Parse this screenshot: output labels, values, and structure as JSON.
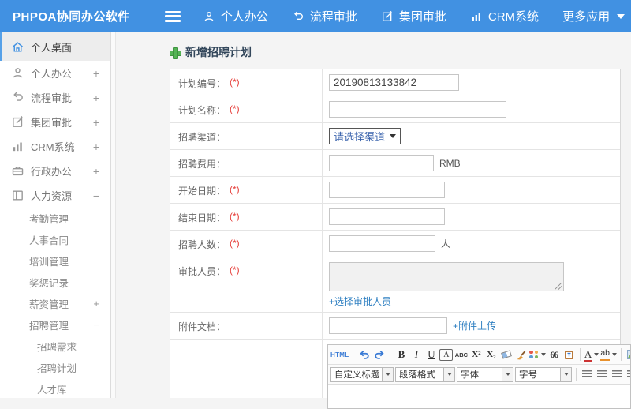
{
  "colors": {
    "topbar_blue": "#4191e2",
    "active_border_blue": "#57a1e8",
    "link_blue": "#2e7fc1",
    "required_red": "#e6403c",
    "title_plus_green": "#55b455"
  },
  "topbar": {
    "logo": "PHPOA协同办公软件",
    "nav": [
      {
        "label": "个人办公",
        "icon": "person-icon"
      },
      {
        "label": "流程审批",
        "icon": "process-arrow-icon"
      },
      {
        "label": "集团审批",
        "icon": "edit-square-icon"
      },
      {
        "label": "CRM系统",
        "icon": "bar-chart-icon"
      },
      {
        "label": "更多应用",
        "icon": "caret-down-icon"
      }
    ]
  },
  "sidebar": {
    "items": [
      {
        "label": "个人桌面",
        "icon": "home-icon",
        "active": true,
        "expander": ""
      },
      {
        "label": "个人办公",
        "icon": "person-icon",
        "expander": "+"
      },
      {
        "label": "流程审批",
        "icon": "process-arrow-icon",
        "expander": "+"
      },
      {
        "label": "集团审批",
        "icon": "edit-square-icon",
        "expander": "+"
      },
      {
        "label": "CRM系统",
        "icon": "bar-chart-icon",
        "expander": "+"
      },
      {
        "label": "行政办公",
        "icon": "briefcase-icon",
        "expander": "+"
      },
      {
        "label": "人力资源",
        "icon": "book-icon",
        "expander": "−"
      }
    ],
    "hr_submenu": [
      {
        "label": "考勤管理",
        "expander": ""
      },
      {
        "label": "人事合同",
        "expander": ""
      },
      {
        "label": "培训管理",
        "expander": ""
      },
      {
        "label": "奖惩记录",
        "expander": ""
      },
      {
        "label": "薪资管理",
        "expander": "+"
      },
      {
        "label": "招聘管理",
        "expander": "−"
      }
    ],
    "recruit_submenu": [
      {
        "label": "招聘需求"
      },
      {
        "label": "招聘计划"
      },
      {
        "label": "人才库"
      }
    ]
  },
  "main": {
    "title": "新增招聘计划",
    "form": {
      "rows": [
        {
          "label": "计划编号：",
          "required": "(*)",
          "value": "20190813133842"
        },
        {
          "label": "计划名称：",
          "required": "(*)",
          "value": ""
        },
        {
          "label": "招聘渠道：",
          "select_value": "请选择渠道"
        },
        {
          "label": "招聘费用：",
          "value": "",
          "suffix": "RMB"
        },
        {
          "label": "开始日期：",
          "required": "(*)",
          "value": ""
        },
        {
          "label": "结束日期：",
          "required": "(*)",
          "value": ""
        },
        {
          "label": "招聘人数：",
          "required": "(*)",
          "value": "",
          "suffix": "人"
        },
        {
          "label": "审批人员：",
          "required": "(*)",
          "link": "+选择审批人员"
        },
        {
          "label": "附件文档：",
          "value": "",
          "link": "+附件上传"
        }
      ]
    },
    "editor": {
      "source_button": "HTML",
      "buttons": {
        "bold": "B",
        "italic": "I",
        "underline": "U",
        "char_border": "A",
        "strike": "ABC",
        "superscript": "X²",
        "subscript": "X₂",
        "quote": "66",
        "font_color": "A",
        "highlight": "ab"
      },
      "dropdowns": [
        {
          "label": "自定义标题"
        },
        {
          "label": "段落格式"
        },
        {
          "label": "字体"
        },
        {
          "label": "字号"
        }
      ],
      "icon_names": [
        "undo-icon",
        "redo-icon",
        "eraser-icon",
        "format-brush-icon",
        "color-palette-icon",
        "paste-text-icon",
        "align-left-icon",
        "align-center-icon",
        "align-right-icon",
        "align-justify-icon",
        "link-icon",
        "unlink-icon"
      ]
    }
  }
}
